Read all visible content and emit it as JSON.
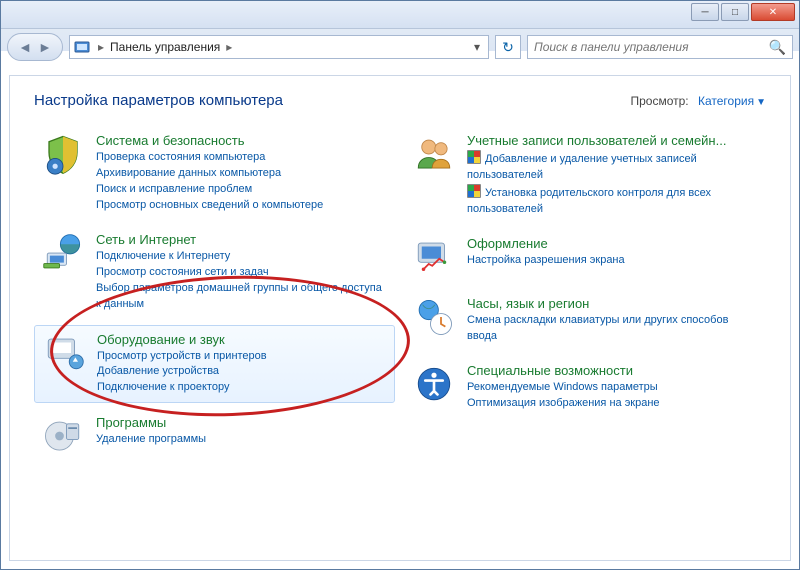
{
  "window": {
    "breadcrumb_root": "Панель управления",
    "search_placeholder": "Поиск в панели управления"
  },
  "page": {
    "title": "Настройка параметров компьютера",
    "view_label": "Просмотр:",
    "view_value": "Категория"
  },
  "left": {
    "system": {
      "title": "Система и безопасность",
      "tasks": [
        "Проверка состояния компьютера",
        "Архивирование данных компьютера",
        "Поиск и исправление проблем",
        "Просмотр основных сведений о компьютере"
      ]
    },
    "network": {
      "title": "Сеть и Интернет",
      "tasks": [
        "Подключение к Интернету",
        "Просмотр состояния сети и задач",
        "Выбор параметров домашней группы и общего доступа к данным"
      ]
    },
    "hardware": {
      "title": "Оборудование и звук",
      "tasks": [
        "Просмотр устройств и принтеров",
        "Добавление устройства",
        "Подключение к проектору"
      ]
    },
    "programs": {
      "title": "Программы",
      "tasks": [
        "Удаление программы"
      ]
    }
  },
  "right": {
    "users": {
      "title": "Учетные записи пользователей и семейн...",
      "tasks": [
        "Добавление и удаление учетных записей пользователей",
        "Установка родительского контроля для всех пользователей"
      ],
      "shielded": [
        0,
        1
      ]
    },
    "appearance": {
      "title": "Оформление",
      "tasks": [
        "Настройка разрешения экрана"
      ]
    },
    "clock": {
      "title": "Часы, язык и регион",
      "tasks": [
        "Смена раскладки клавиатуры или других способов ввода"
      ]
    },
    "ease": {
      "title": "Специальные возможности",
      "tasks": [
        "Рекомендуемые Windows параметры",
        "Оптимизация изображения на экране"
      ]
    }
  }
}
